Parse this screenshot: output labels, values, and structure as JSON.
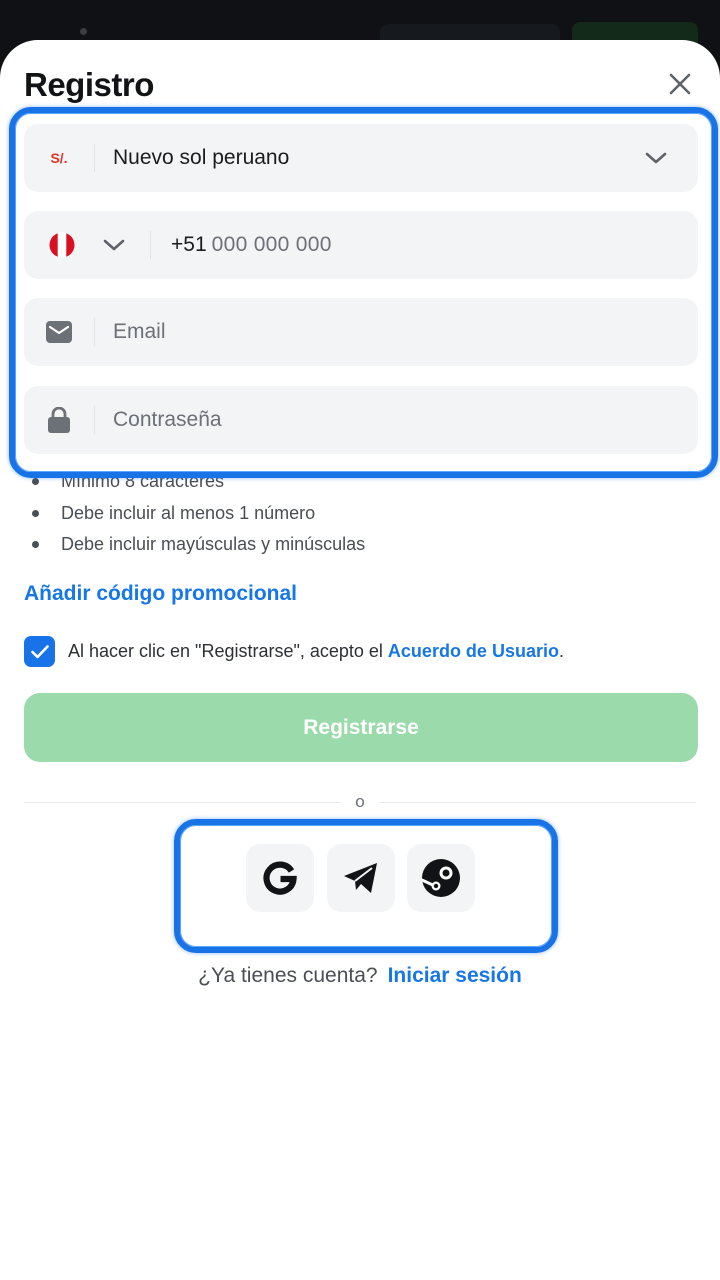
{
  "header": {
    "title": "Registro"
  },
  "currency": {
    "symbol": "S/.",
    "name": "Nuevo sol peruano"
  },
  "phone": {
    "dial_code": "+51",
    "placeholder": "000 000 000"
  },
  "email": {
    "placeholder": "Email"
  },
  "password": {
    "placeholder": "Contraseña"
  },
  "password_rules": [
    "Mínimo 8 caracteres",
    "Debe incluir al menos 1 número",
    "Debe incluir mayúsculas y minúsculas"
  ],
  "promo": {
    "label": "Añadir código promocional"
  },
  "agreement": {
    "checked": true,
    "text": "Al hacer clic en \"Registrarse\", acepto el ",
    "link": "Acuerdo de Usuario",
    "suffix": "."
  },
  "register": {
    "label": "Registrarse"
  },
  "divider": {
    "text": "o"
  },
  "social": [
    {
      "icon": "google-icon"
    },
    {
      "icon": "telegram-icon"
    },
    {
      "icon": "steam-icon"
    }
  ],
  "login": {
    "question": "¿Ya tienes cuenta?",
    "link": "Iniciar sesión"
  },
  "colors": {
    "accent": "#1877e6",
    "register_disabled": "#9bdaab",
    "field_bg": "#f3f4f5",
    "highlight": "#1874e6"
  }
}
